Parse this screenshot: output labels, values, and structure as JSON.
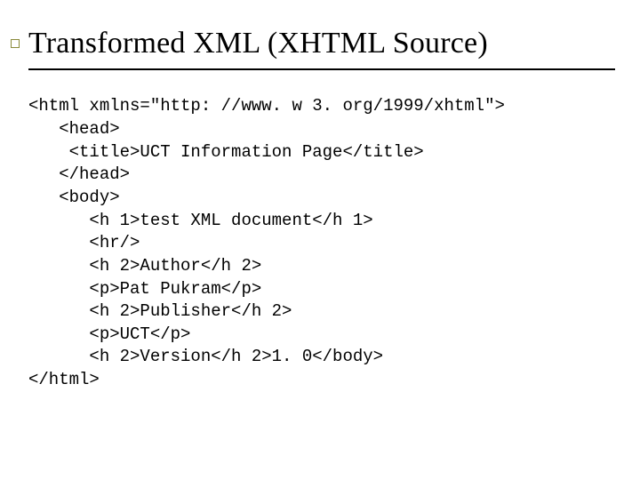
{
  "title": "Transformed XML (XHTML Source)",
  "code": {
    "l1": "<html xmlns=\"http: //www. w 3. org/1999/xhtml\">",
    "l2": "   <head>",
    "l3": "    <title>UCT Information Page</title>",
    "l4": "   </head>",
    "l5": "   <body>",
    "l6": "      <h 1>test XML document</h 1>",
    "l7": "      <hr/>",
    "l8": "      <h 2>Author</h 2>",
    "l9": "      <p>Pat Pukram</p>",
    "l10": "      <h 2>Publisher</h 2>",
    "l11": "      <p>UCT</p>",
    "l12": "      <h 2>Version</h 2>1. 0</body>",
    "l13": "</html>"
  }
}
